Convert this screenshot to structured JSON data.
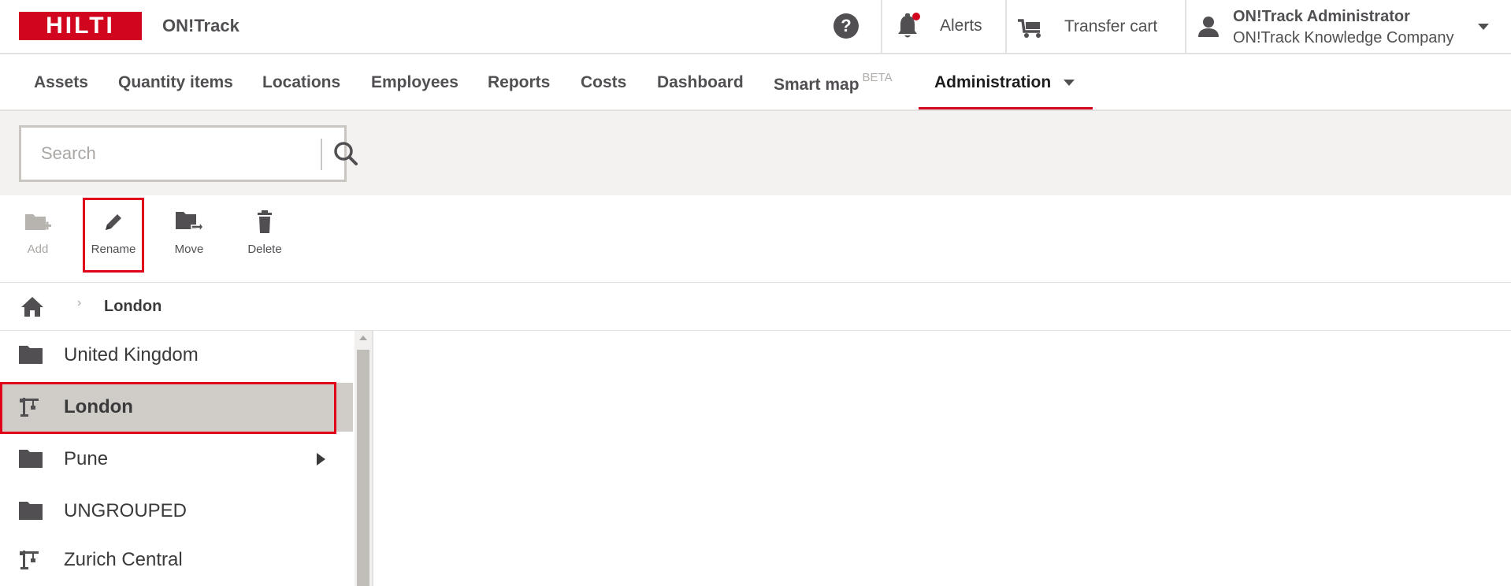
{
  "header": {
    "logo_text": "HILTI",
    "app_title": "ON!Track",
    "help_label": "?",
    "alerts_label": "Alerts",
    "transfer_cart_label": "Transfer cart",
    "user_name": "ON!Track Administrator",
    "user_company": "ON!Track Knowledge Company",
    "brand_color": "#d2051e"
  },
  "nav": {
    "items": [
      {
        "label": "Assets"
      },
      {
        "label": "Quantity items"
      },
      {
        "label": "Locations"
      },
      {
        "label": "Employees"
      },
      {
        "label": "Reports"
      },
      {
        "label": "Costs"
      },
      {
        "label": "Dashboard"
      },
      {
        "label": "Smart map",
        "badge": "BETA"
      },
      {
        "label": "Administration",
        "active": true
      }
    ]
  },
  "search": {
    "placeholder": "Search",
    "value": ""
  },
  "toolbar": {
    "add_label": "Add",
    "rename_label": "Rename",
    "move_label": "Move",
    "delete_label": "Delete"
  },
  "breadcrumb": {
    "current": "London"
  },
  "tree": {
    "items": [
      {
        "label": "United Kingdom",
        "icon": "folder-icon"
      },
      {
        "label": "London",
        "icon": "crane-icon",
        "selected": true
      },
      {
        "label": "Pune",
        "icon": "folder-icon",
        "expandable": true
      },
      {
        "label": "UNGROUPED",
        "icon": "folder-icon"
      },
      {
        "label": "Zurich Central",
        "icon": "crane-icon"
      }
    ]
  },
  "colors": {
    "highlight": "#e1001a",
    "selected_row": "#d0cdc8",
    "search_band": "#f3f2f1"
  }
}
